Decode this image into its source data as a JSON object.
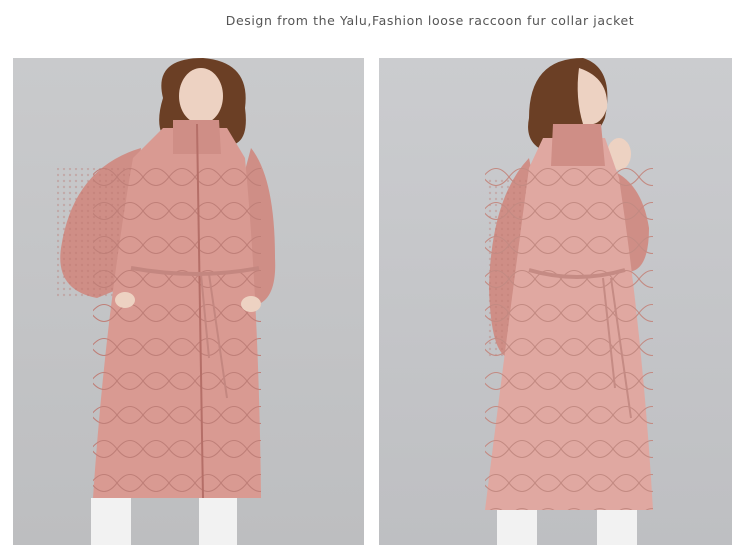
{
  "header": {
    "title": "Design from the Yalu,Fashion loose raccoon fur collar jacket"
  },
  "photos": [
    {
      "name": "model-front-photo",
      "subject": "model wearing pink quilted long down coat with knit sleeves, front view"
    },
    {
      "name": "model-side-photo",
      "subject": "model wearing pink quilted long down coat with knit sleeves, three-quarter view"
    }
  ],
  "colors": {
    "background": "#ffffff",
    "photo_backdrop": "#c7c8ca",
    "coat_pink": "#d99a92",
    "knit_pink": "#cf8e86",
    "hair": "#6b3f25",
    "skin": "#edd2c2",
    "trousers": "#f2f2f2",
    "title_text": "#555555"
  }
}
